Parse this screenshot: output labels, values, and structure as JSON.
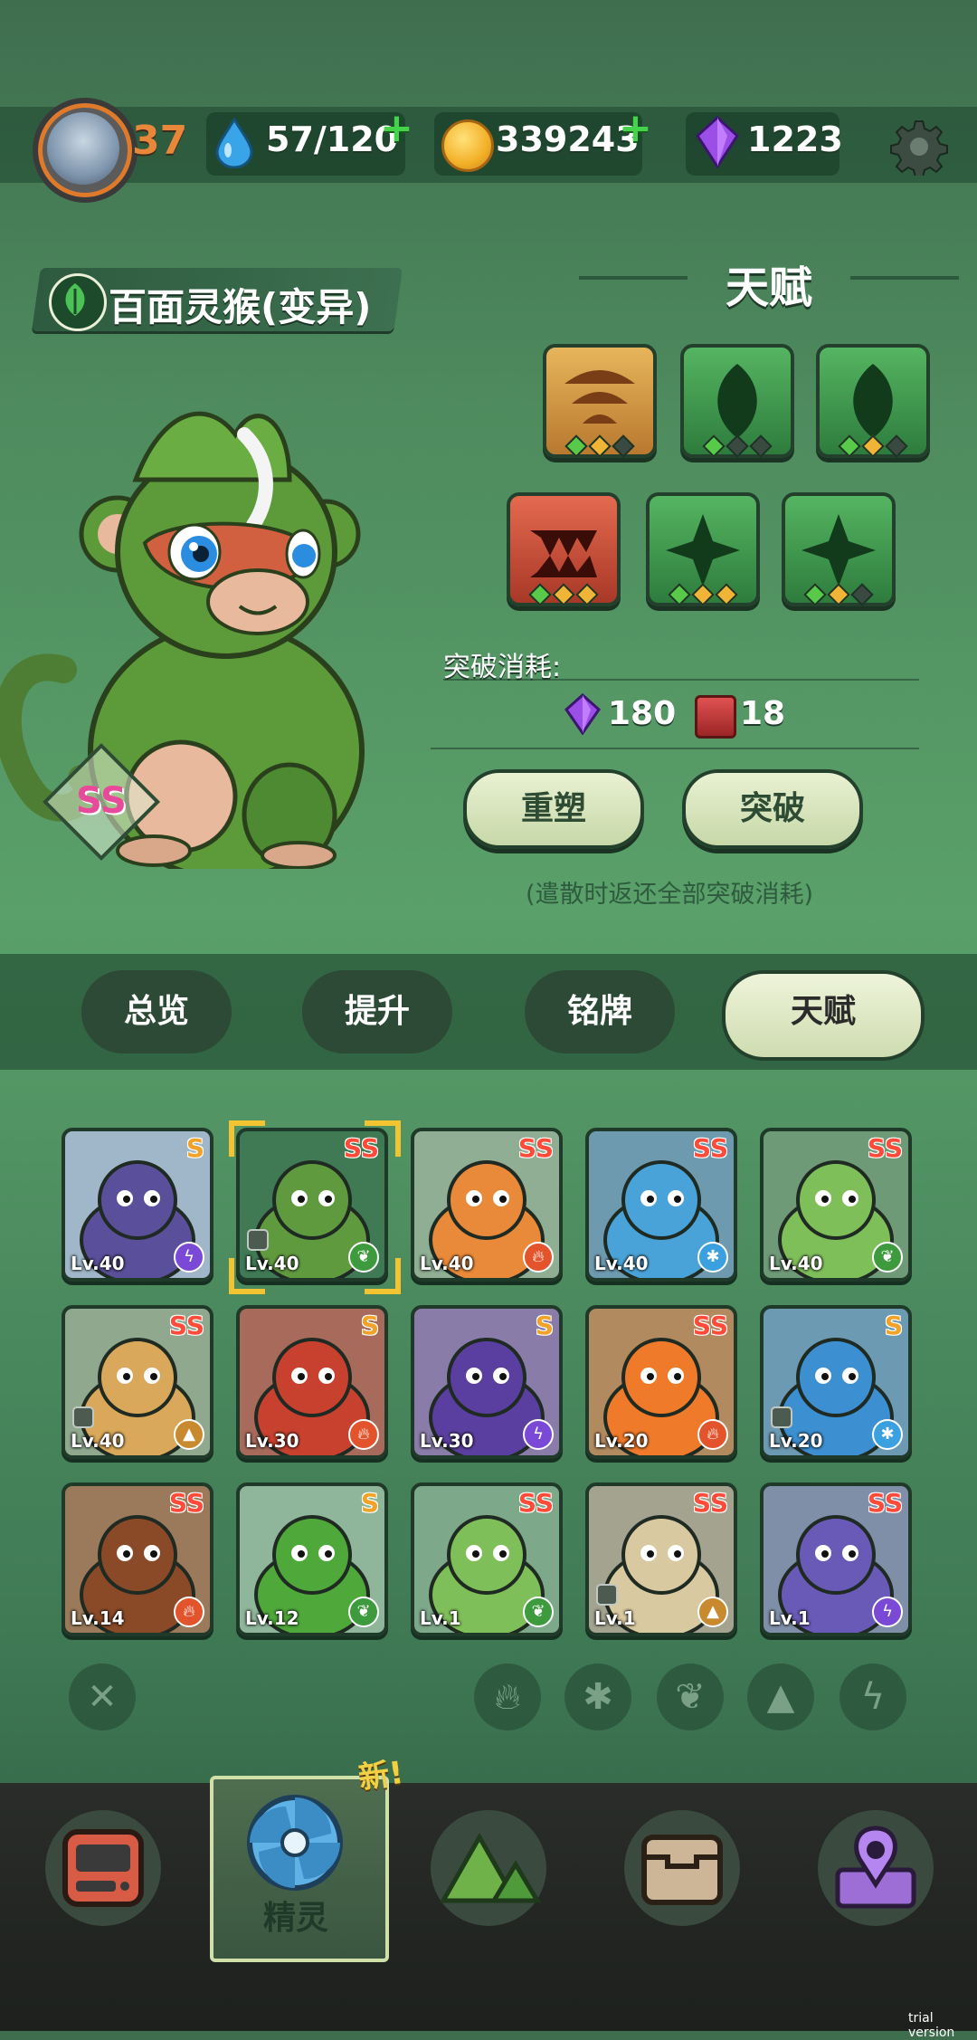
{
  "topbar": {
    "level": "37",
    "stamina": "57/120",
    "coins": "339243",
    "gems": "1223"
  },
  "pet": {
    "name": "百面灵猴(变异)",
    "element": "leaf",
    "rank": "SS"
  },
  "talent": {
    "title": "天赋",
    "slots": [
      {
        "icon": "shell-icon",
        "style": "gold",
        "gems": [
          "green",
          "yellow",
          "dark"
        ]
      },
      {
        "icon": "leaf-drop-icon",
        "style": "green",
        "gems": [
          "green",
          "dark",
          "dark"
        ]
      },
      {
        "icon": "leaf-drop-icon",
        "style": "green",
        "gems": [
          "green",
          "yellow",
          "dark"
        ]
      },
      {
        "icon": "fang-icon",
        "style": "red",
        "gems": [
          "green",
          "yellow",
          "yellow"
        ]
      },
      {
        "icon": "thorn-icon",
        "style": "green",
        "gems": [
          "green",
          "yellow",
          "yellow"
        ]
      },
      {
        "icon": "thorn-icon",
        "style": "green",
        "gems": [
          "green",
          "yellow",
          "dark"
        ]
      }
    ],
    "cost_label": "突破消耗:",
    "cost_gems": "180",
    "cost_books": "18",
    "reshape_label": "重塑",
    "breakthrough_label": "突破",
    "note": "(遣散时返还全部突破消耗)"
  },
  "tabs": [
    {
      "label": "总览",
      "active": false
    },
    {
      "label": "提升",
      "active": false
    },
    {
      "label": "铭牌",
      "active": false
    },
    {
      "label": "天赋",
      "active": true
    }
  ],
  "pets": [
    {
      "rank": "S",
      "level": "Lv.40",
      "element": "lightning",
      "bg": "#9fb7c9",
      "body": "#5a4f9a",
      "locked": false
    },
    {
      "rank": "SS",
      "level": "Lv.40",
      "element": "leaf",
      "bg": "#3f7a55",
      "body": "#5f9a3f",
      "locked": true,
      "selected": true
    },
    {
      "rank": "SS",
      "level": "Lv.40",
      "element": "fire",
      "bg": "#8fae93",
      "body": "#e98a3a",
      "locked": false
    },
    {
      "rank": "SS",
      "level": "Lv.40",
      "element": "ice",
      "bg": "#6e9ab0",
      "body": "#4aa3d8",
      "locked": false
    },
    {
      "rank": "SS",
      "level": "Lv.40",
      "element": "leaf",
      "bg": "#6f9a78",
      "body": "#7fbf5a",
      "locked": false
    },
    {
      "rank": "SS",
      "level": "Lv.40",
      "element": "earth",
      "bg": "#8fa88e",
      "body": "#d9a85a",
      "locked": true
    },
    {
      "rank": "S",
      "level": "Lv.30",
      "element": "fire",
      "bg": "#a86b5b",
      "body": "#c8412f",
      "locked": false
    },
    {
      "rank": "S",
      "level": "Lv.30",
      "element": "lightning",
      "bg": "#8a7ca8",
      "body": "#5b3fa0",
      "locked": false
    },
    {
      "rank": "SS",
      "level": "Lv.20",
      "element": "fire",
      "bg": "#b28a5f",
      "body": "#ef7a2a",
      "locked": false
    },
    {
      "rank": "S",
      "level": "Lv.20",
      "element": "ice",
      "bg": "#6c9ab2",
      "body": "#3c8fd0",
      "locked": true
    },
    {
      "rank": "SS",
      "level": "Lv.14",
      "element": "fire",
      "bg": "#9a7a5a",
      "body": "#8a4a28",
      "locked": false
    },
    {
      "rank": "S",
      "level": "Lv.12",
      "element": "leaf",
      "bg": "#8fb59a",
      "body": "#4fa83a",
      "locked": false
    },
    {
      "rank": "SS",
      "level": "Lv.1",
      "element": "leaf",
      "bg": "#7ea88a",
      "body": "#7fbf5a",
      "locked": false
    },
    {
      "rank": "SS",
      "level": "Lv.1",
      "element": "earth",
      "bg": "#a3a38f",
      "body": "#d8c9a0",
      "locked": true
    },
    {
      "rank": "SS",
      "level": "Lv.1",
      "element": "lightning",
      "bg": "#7f8fa8",
      "body": "#6a5ab8",
      "locked": false
    }
  ],
  "filters": [
    "close",
    "fire",
    "ice",
    "leaf",
    "earth",
    "lightning"
  ],
  "nav": {
    "active_label": "精灵",
    "new_badge": "新!"
  },
  "watermark": "trial version",
  "colors": {
    "fire": "#e3542c",
    "ice": "#3aa0e0",
    "leaf": "#3d9b3e",
    "lightning": "#7a49d6",
    "earth": "#c98a2f",
    "gem_green": "#59c94a",
    "gem_yellow": "#f0b437",
    "gem_dark": "#3a4a40"
  }
}
